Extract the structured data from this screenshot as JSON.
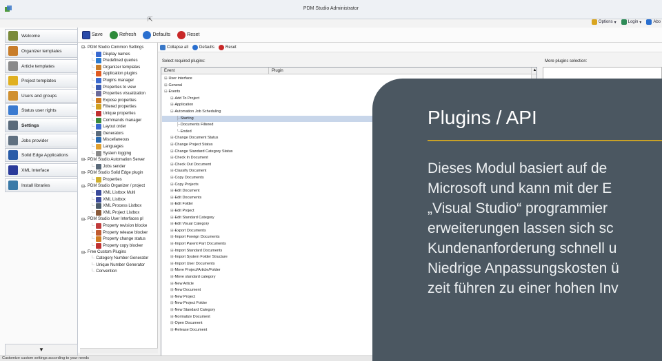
{
  "window": {
    "title": "PDM Studio Administrator",
    "right_menu": [
      {
        "label": "Options",
        "icon": "options-icon",
        "color": "#d9a520"
      },
      {
        "label": "Login",
        "icon": "login-icon",
        "color": "#2e8b57"
      },
      {
        "label": "Abo",
        "icon": "info-icon",
        "color": "#2a6fcf"
      }
    ]
  },
  "sidebar": {
    "items": [
      {
        "label": "Welcome",
        "icon": "welcome-icon",
        "color": "#7a8a3a"
      },
      {
        "label": "Organizer templates",
        "icon": "organizer-templates-icon",
        "color": "#c87d2a"
      },
      {
        "label": "Article templates",
        "icon": "article-templates-icon",
        "color": "#8a8a8a"
      },
      {
        "label": "Project templates",
        "icon": "project-templates-icon",
        "color": "#e0b020"
      },
      {
        "label": "Users and groups",
        "icon": "users-icon",
        "color": "#d09030"
      },
      {
        "label": "Status user rights",
        "icon": "status-rights-icon",
        "color": "#3a7ad0"
      },
      {
        "label": "Settings",
        "icon": "gear-icon",
        "color": "#5a6a7a",
        "selected": true
      },
      {
        "label": "Jobs provider",
        "icon": "jobs-provider-icon",
        "color": "#607080"
      },
      {
        "label": "Solid Edge Applications",
        "icon": "solid-edge-icon",
        "color": "#2a5ca8"
      },
      {
        "label": "XML Interface",
        "icon": "xml-icon",
        "color": "#2a3a9a"
      },
      {
        "label": "Install libraries",
        "icon": "install-icon",
        "color": "#3a7aa8"
      }
    ],
    "scroll_glyph": "▼"
  },
  "toolbar": {
    "save_label": "Save",
    "refresh_label": "Refresh",
    "defaults_label": "Defaults",
    "reset_label": "Reset"
  },
  "tree": {
    "nodes": [
      {
        "label": "PDM Studio Common Settings",
        "level": 0,
        "prefix": "⊟-"
      },
      {
        "label": "Display names",
        "level": 1,
        "color": "#3a6ad0"
      },
      {
        "label": "Predefined queries",
        "level": 1,
        "color": "#2a7ad0"
      },
      {
        "label": "Organizer templates",
        "level": 1,
        "color": "#c87d2a"
      },
      {
        "label": "Application plugins",
        "level": 1,
        "color": "#e05a20"
      },
      {
        "label": "Plugins manager",
        "level": 1,
        "color": "#3a6ad0"
      },
      {
        "label": "Properties to view",
        "level": 1,
        "color": "#3a5ab0"
      },
      {
        "label": "Properties visualization",
        "level": 1,
        "color": "#6a6a9a"
      },
      {
        "label": "Expose properties",
        "level": 1,
        "color": "#d07a20"
      },
      {
        "label": "Filtered properties",
        "level": 1,
        "color": "#d0a020"
      },
      {
        "label": "Unique properties",
        "level": 1,
        "color": "#c03030"
      },
      {
        "label": "Commands manager",
        "level": 1,
        "color": "#3a8a3a"
      },
      {
        "label": "Layout order",
        "level": 1,
        "color": "#3a6ad0"
      },
      {
        "label": "Generators",
        "level": 1,
        "color": "#5a6a7a"
      },
      {
        "label": "Miscellaneous",
        "level": 1,
        "color": "#2a6ab0"
      },
      {
        "label": "Languages",
        "level": 1,
        "color": "#e0a030"
      },
      {
        "label": "System logging",
        "level": 1,
        "color": "#8a8a8a"
      },
      {
        "label": "PDM Studio Automation Server",
        "level": 0,
        "prefix": "⊟-"
      },
      {
        "label": "Jobs sender",
        "level": 1,
        "color": "#5a6a7a"
      },
      {
        "label": "PDM Studio Solid Edge plugin",
        "level": 0,
        "prefix": "⊟-"
      },
      {
        "label": "Properties",
        "level": 1,
        "color": "#d0b030"
      },
      {
        "label": "PDM Studio Organizer / project",
        "level": 0,
        "prefix": "⊟-"
      },
      {
        "label": "XML Listbox Multi",
        "level": 1,
        "color": "#3a4a9a"
      },
      {
        "label": "XML Listbox",
        "level": 1,
        "color": "#3a4a9a"
      },
      {
        "label": "XML Process Listbox",
        "level": 1,
        "color": "#4a5a6a"
      },
      {
        "label": "XML Project Listbox",
        "level": 1,
        "color": "#8a5a3a"
      },
      {
        "label": "PDM Studio User Interfaces pl",
        "level": 0,
        "prefix": "⊟-"
      },
      {
        "label": "Property revision blocke",
        "level": 1,
        "color": "#c03a3a"
      },
      {
        "label": "Property release blocker",
        "level": 1,
        "color": "#c05a30"
      },
      {
        "label": "Property change status",
        "level": 1,
        "color": "#d07a20"
      },
      {
        "label": "Property copy blocker",
        "level": 1,
        "color": "#c03030"
      },
      {
        "label": "Free Custom Plugins",
        "level": 0,
        "prefix": "⊟-"
      },
      {
        "label": "Category Number Generator",
        "level": 1,
        "color": ""
      },
      {
        "label": "Unique Number Generator",
        "level": 1,
        "color": ""
      },
      {
        "label": "Convention",
        "level": 1,
        "color": ""
      }
    ]
  },
  "main": {
    "collapse_all_label": "Collapse all",
    "defaults_label": "Defaults",
    "reset_label": "Reset",
    "select_required_label": "Select required plugins:",
    "more_plugins_label": "More plugins selection:",
    "col_event": "Event",
    "col_plugin": "Plugin",
    "scroll_up_glyph": "▲",
    "rows": [
      {
        "label": "User interface",
        "level": 0,
        "prefix": "⊞-"
      },
      {
        "label": "General",
        "level": 0,
        "prefix": "⊞-"
      },
      {
        "label": "Events",
        "level": 0,
        "prefix": "⊟-"
      },
      {
        "label": "Add To Project",
        "level": 1,
        "prefix": "⊞-"
      },
      {
        "label": "Application",
        "level": 1,
        "prefix": "⊞-"
      },
      {
        "label": "Automation Job Scheduling",
        "level": 1,
        "prefix": "⊟-"
      },
      {
        "label": "Starting",
        "level": 2,
        "prefix": "├-",
        "selected": true
      },
      {
        "label": "Documents Filtered",
        "level": 2,
        "prefix": "├-"
      },
      {
        "label": "Ended",
        "level": 2,
        "prefix": "└-"
      },
      {
        "label": "Change Document Status",
        "level": 1,
        "prefix": "⊞-"
      },
      {
        "label": "Change Project Status",
        "level": 1,
        "prefix": "⊞-"
      },
      {
        "label": "Change Standard Category Status",
        "level": 1,
        "prefix": "⊞-"
      },
      {
        "label": "Check In Document",
        "level": 1,
        "prefix": "⊞-"
      },
      {
        "label": "Check Out Document",
        "level": 1,
        "prefix": "⊞-"
      },
      {
        "label": "Classify Document",
        "level": 1,
        "prefix": "⊞-"
      },
      {
        "label": "Copy Documents",
        "level": 1,
        "prefix": "⊞-"
      },
      {
        "label": "Copy Projects",
        "level": 1,
        "prefix": "⊞-"
      },
      {
        "label": "Edit Document",
        "level": 1,
        "prefix": "⊞-"
      },
      {
        "label": "Edit Documents",
        "level": 1,
        "prefix": "⊞-"
      },
      {
        "label": "Edit Folder",
        "level": 1,
        "prefix": "⊞-"
      },
      {
        "label": "Edit Project",
        "level": 1,
        "prefix": "⊞-"
      },
      {
        "label": "Edit Standard Category",
        "level": 1,
        "prefix": "⊞-"
      },
      {
        "label": "Edit Visual Category",
        "level": 1,
        "prefix": "⊞-"
      },
      {
        "label": "Export Documents",
        "level": 1,
        "prefix": "⊞-"
      },
      {
        "label": "Import Foreign Documents",
        "level": 1,
        "prefix": "⊞-"
      },
      {
        "label": "Import Parent Part Documents",
        "level": 1,
        "prefix": "⊞-"
      },
      {
        "label": "Import Standard Documents",
        "level": 1,
        "prefix": "⊞-"
      },
      {
        "label": "Import System Folder Structure",
        "level": 1,
        "prefix": "⊞-"
      },
      {
        "label": "Import User Documents",
        "level": 1,
        "prefix": "⊞-"
      },
      {
        "label": "Move Project/Article/Folder",
        "level": 1,
        "prefix": "⊞-"
      },
      {
        "label": "Move standard category",
        "level": 1,
        "prefix": "⊞-"
      },
      {
        "label": "New Article",
        "level": 1,
        "prefix": "⊞-"
      },
      {
        "label": "New Document",
        "level": 1,
        "prefix": "⊞-"
      },
      {
        "label": "New Project",
        "level": 1,
        "prefix": "⊞-"
      },
      {
        "label": "New Project Folder",
        "level": 1,
        "prefix": "⊞-"
      },
      {
        "label": "New Standard Category",
        "level": 1,
        "prefix": "⊞-"
      },
      {
        "label": "Normalize Document",
        "level": 1,
        "prefix": "⊞-"
      },
      {
        "label": "Open Document",
        "level": 1,
        "prefix": "⊞-"
      },
      {
        "label": "Release Document",
        "level": 1,
        "prefix": "⊞-"
      }
    ]
  },
  "status_bar": "Customize custom settings according to your needs",
  "overlay": {
    "title": "Plugins / API",
    "lines": [
      "Dieses Modul basiert auf de",
      "Microsoft und kann mit der E",
      "„Visual Studio“ programmier",
      "erweiterungen lassen sich sc",
      "Kundenanforderung schnell u",
      "Niedrige Anpassungskosten ü",
      "zeit führen zu einer hohen Inv"
    ],
    "accent": "#c9a227",
    "background": "#4b5761"
  }
}
